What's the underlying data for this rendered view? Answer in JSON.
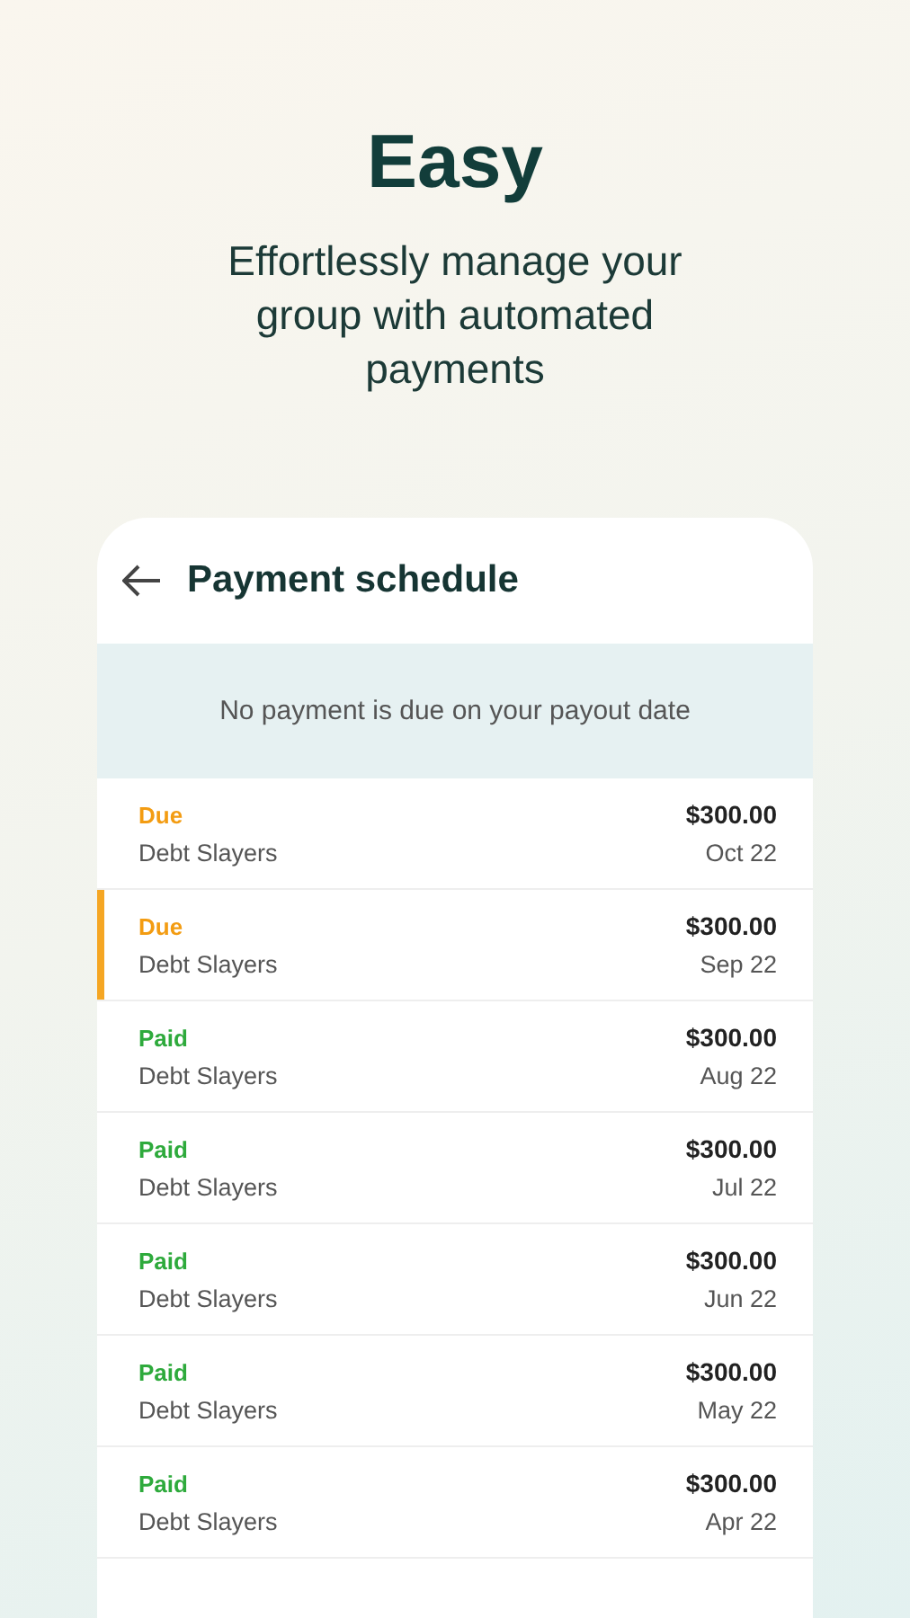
{
  "hero": {
    "title": "Easy",
    "subtitle": "Effortlessly manage your group with automated payments"
  },
  "screen": {
    "title": "Payment schedule",
    "notice": "No payment is due on your payout date",
    "payments": [
      {
        "status": "Due",
        "kind": "due",
        "group": "Debt Slayers",
        "amount": "$300.00",
        "date": "Oct 22",
        "selected": false
      },
      {
        "status": "Due",
        "kind": "due",
        "group": "Debt Slayers",
        "amount": "$300.00",
        "date": "Sep 22",
        "selected": true
      },
      {
        "status": "Paid",
        "kind": "paid",
        "group": "Debt Slayers",
        "amount": "$300.00",
        "date": "Aug 22",
        "selected": false
      },
      {
        "status": "Paid",
        "kind": "paid",
        "group": "Debt Slayers",
        "amount": "$300.00",
        "date": "Jul 22",
        "selected": false
      },
      {
        "status": "Paid",
        "kind": "paid",
        "group": "Debt Slayers",
        "amount": "$300.00",
        "date": "Jun 22",
        "selected": false
      },
      {
        "status": "Paid",
        "kind": "paid",
        "group": "Debt Slayers",
        "amount": "$300.00",
        "date": "May 22",
        "selected": false
      },
      {
        "status": "Paid",
        "kind": "paid",
        "group": "Debt Slayers",
        "amount": "$300.00",
        "date": "Apr 22",
        "selected": false
      }
    ]
  }
}
